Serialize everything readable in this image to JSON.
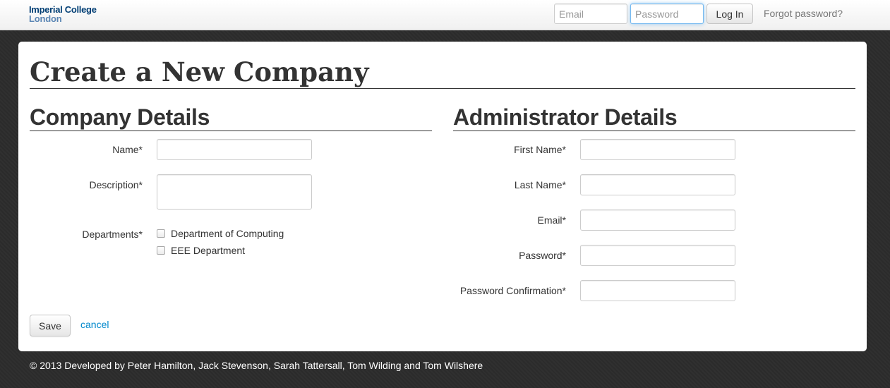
{
  "navbar": {
    "brand_line1": "Imperial College",
    "brand_line2": "London",
    "email_placeholder": "Email",
    "password_placeholder": "Password",
    "login_label": "Log In",
    "forgot_label": "Forgot password?"
  },
  "page": {
    "title": "Create a New Company"
  },
  "company": {
    "title": "Company Details",
    "name_label": "Name*",
    "description_label": "Description*",
    "departments_label": "Departments*",
    "departments": [
      {
        "label": "Department of Computing",
        "checked": false
      },
      {
        "label": "EEE Department",
        "checked": false
      }
    ]
  },
  "admin": {
    "title": "Administrator Details",
    "first_name_label": "First Name*",
    "last_name_label": "Last Name*",
    "email_label": "Email*",
    "password_label": "Password*",
    "password_confirmation_label": "Password Confirmation*"
  },
  "actions": {
    "save_label": "Save",
    "cancel_label": "cancel"
  },
  "footer": {
    "text": "© 2013 Developed by Peter Hamilton, Jack Stevenson, Sarah Tattersall, Tom Wilding and Tom Wilshere"
  },
  "colors": {
    "brand_dark": "#003e74",
    "brand_light": "#5b86b4",
    "link": "#0088cc",
    "background": "#2b2b2b"
  }
}
